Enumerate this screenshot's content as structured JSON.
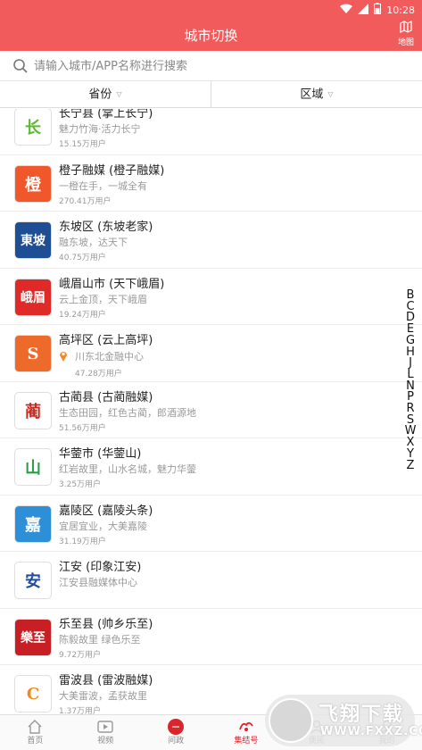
{
  "status": {
    "time": "10:28",
    "icons": [
      "wifi-icon",
      "signal-icon",
      "battery-icon"
    ]
  },
  "header": {
    "title": "城市切换",
    "map_label": "地图"
  },
  "search": {
    "placeholder": "请输入城市/APP名称进行搜索"
  },
  "filters": [
    {
      "label": "省份"
    },
    {
      "label": "区域"
    }
  ],
  "items": [
    {
      "name": "长宁县 (掌上长宁)",
      "slogan": "魅力竹海·活力长宁",
      "users": "15.15万用户",
      "logo_text": "长",
      "logo_color": "#5fb832",
      "logo_bg": "#ffffff"
    },
    {
      "name": "橙子融媒 (橙子融媒)",
      "slogan": "一橙在手，一城全有",
      "users": "270.41万用户",
      "logo_text": "橙",
      "logo_color": "#ffffff",
      "logo_bg": "#f0582c"
    },
    {
      "name": "东坡区 (东坡老家)",
      "slogan": "融东坡，达天下",
      "users": "40.75万用户",
      "logo_text": "東坡",
      "logo_color": "#ffffff",
      "logo_bg": "#1e4f95"
    },
    {
      "name": "峨眉山市 (天下峨眉)",
      "slogan": "云上金顶，天下峨眉",
      "users": "19.24万用户",
      "logo_text": "峨眉",
      "logo_color": "#ffffff",
      "logo_bg": "#e02a28"
    },
    {
      "name": "高坪区 (云上高坪)",
      "slogan": "川东北金融中心",
      "users": "47.28万用户",
      "logo_text": "S",
      "logo_color": "#ffffff",
      "logo_bg": "#ee6a2a",
      "pin": true
    },
    {
      "name": "古蔺县 (古蔺融媒)",
      "slogan": "生态田园，红色古蔺，郎酒源地",
      "users": "51.56万用户",
      "logo_text": "蔺",
      "logo_color": "#c8281e",
      "logo_bg": "#ffffff"
    },
    {
      "name": "华蓥市 (华蓥山)",
      "slogan": "红岩故里，山水名城，魅力华蓥",
      "users": "3.25万用户",
      "logo_text": "山",
      "logo_color": "#2f9d4a",
      "logo_bg": "#ffffff"
    },
    {
      "name": "嘉陵区 (嘉陵头条)",
      "slogan": "宜居宜业，大美嘉陵",
      "users": "31.19万用户",
      "logo_text": "嘉",
      "logo_color": "#ffffff",
      "logo_bg": "#2d8fd8"
    },
    {
      "name": "江安 (印象江安)",
      "slogan": "江安县融媒体中心",
      "users": "",
      "logo_text": "安",
      "logo_color": "#1f4e9a",
      "logo_bg": "#ffffff"
    },
    {
      "name": "乐至县 (帅乡乐至)",
      "slogan": "陈毅故里 绿色乐至",
      "users": "9.72万用户",
      "logo_text": "樂至",
      "logo_color": "#ffffff",
      "logo_bg": "#c81f24"
    },
    {
      "name": "雷波县 (雷波融媒)",
      "slogan": "大美雷波，孟获故里",
      "users": "1.37万用户",
      "logo_text": "C",
      "logo_color": "#f08a1c",
      "logo_bg": "#ffffff"
    }
  ],
  "alpha_index": [
    "B",
    "C",
    "D",
    "E",
    "G",
    "H",
    "J",
    "L",
    "N",
    "P",
    "R",
    "S",
    "W",
    "X",
    "Y",
    "Z"
  ],
  "tabs": [
    {
      "label": "首页",
      "icon": "home-icon"
    },
    {
      "label": "视频",
      "icon": "video-icon"
    },
    {
      "label": "问政",
      "icon": "ask-icon"
    },
    {
      "label": "集结号",
      "icon": "rally-icon",
      "active": true
    },
    {
      "label": "便民",
      "icon": "service-icon"
    },
    {
      "label": "我的",
      "icon": "profile-icon"
    }
  ],
  "watermark": {
    "title": "飞翔下载",
    "url": "WWW.FXXZ.COM"
  }
}
